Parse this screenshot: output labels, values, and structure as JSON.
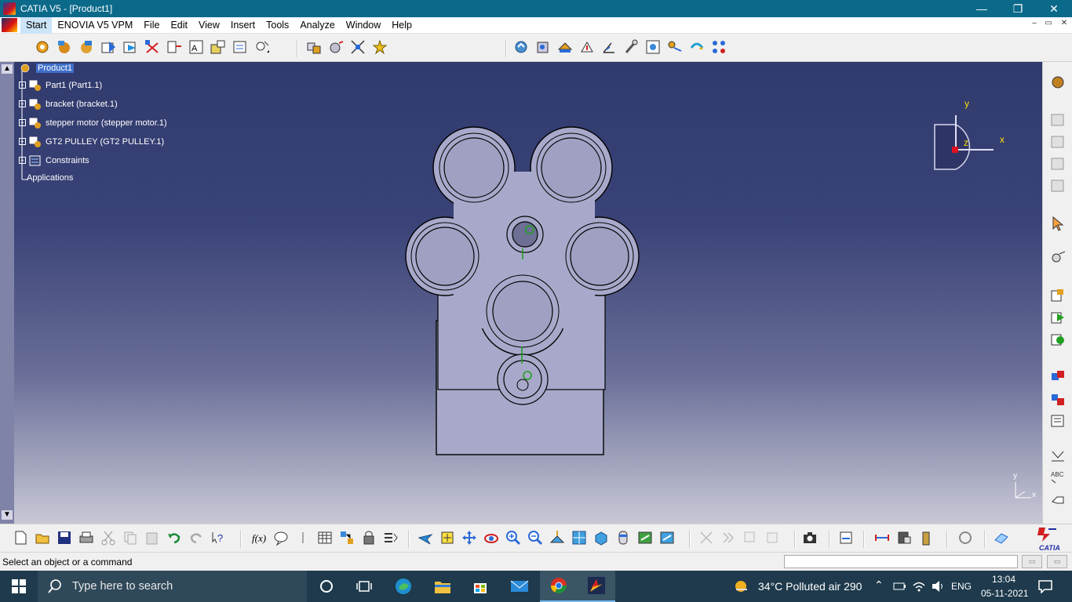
{
  "window": {
    "title": "CATIA V5 - [Product1]",
    "min": "—",
    "max": "❐",
    "close": "✕"
  },
  "menu": {
    "items": [
      "Start",
      "ENOVIA V5 VPM",
      "File",
      "Edit",
      "View",
      "Insert",
      "Tools",
      "Analyze",
      "Window",
      "Help"
    ],
    "mdi": [
      "–",
      "▭",
      "✕"
    ]
  },
  "tree": {
    "root": "Product1",
    "items": [
      "Part1 (Part1.1)",
      "bracket (bracket.1)",
      "stepper motor (stepper motor.1)",
      "GT2 PULLEY (GT2 PULLEY.1)",
      "Constraints"
    ],
    "applications": "Applications"
  },
  "compass": {
    "x": "x",
    "y": "y",
    "z": "z"
  },
  "mini_axis": {
    "x": "x",
    "y": "y"
  },
  "status": {
    "message": "Select an object or a command"
  },
  "taskbar": {
    "search_placeholder": "Type here to search",
    "weather": "34°C  Polluted air 290",
    "lang": "ENG",
    "time": "13:04",
    "date": "05-11-2021"
  },
  "brand": "CATIA",
  "colors": {
    "accent_title": "#0b6a8a",
    "axis_label": "#ffe000",
    "part_fill": "#a9aacb",
    "taskbar": "#1e3a4c"
  }
}
